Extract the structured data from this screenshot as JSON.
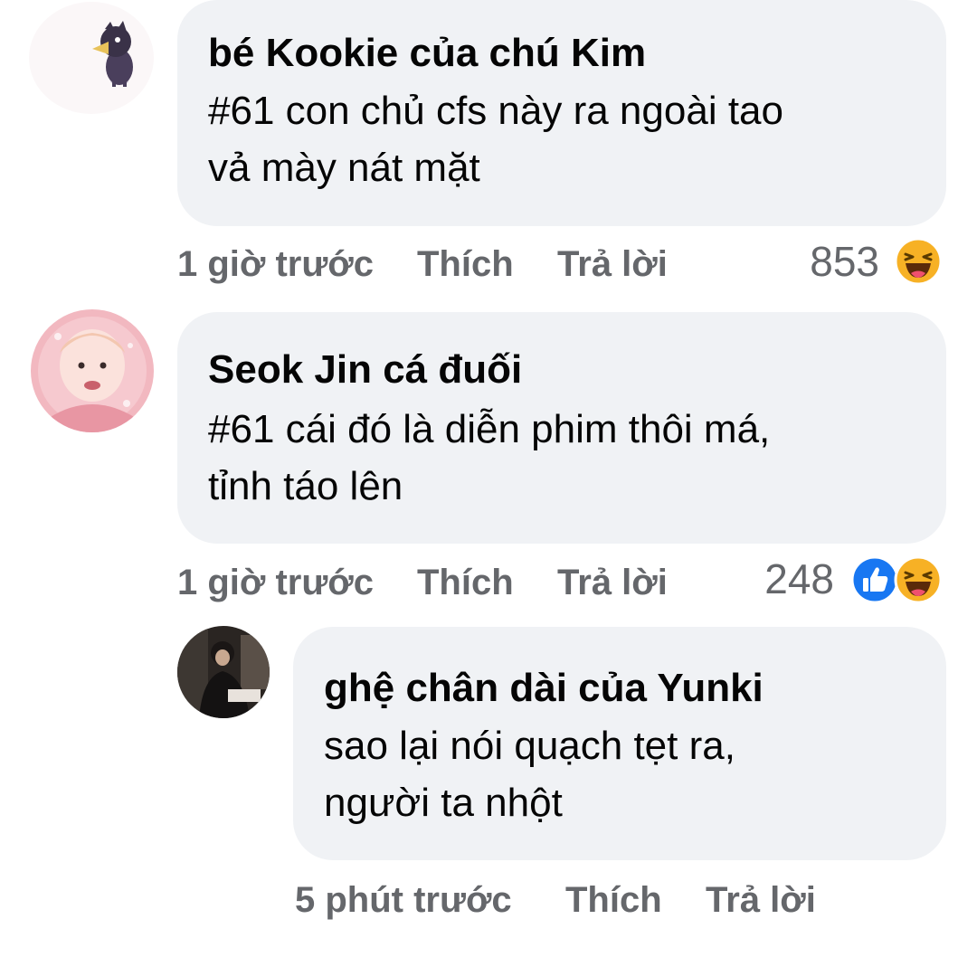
{
  "comments": [
    {
      "author": "bé Kookie của chú Kim",
      "lines": [
        "#61 con chủ cfs này ra ngoài tao",
        "vả mày nát mặt"
      ],
      "time": "1 giờ trước",
      "like_label": "Thích",
      "reply_label": "Trả lời",
      "reaction_count": "853",
      "reactions": [
        "haha-icon"
      ]
    },
    {
      "author": "Seok Jin cá đuối",
      "lines": [
        "#61 cái đó là diễn phim thôi má,",
        "tỉnh táo lên"
      ],
      "time": "1 giờ trước",
      "like_label": "Thích",
      "reply_label": "Trả lời",
      "reaction_count": "248",
      "reactions": [
        "like-icon",
        "haha-icon"
      ]
    },
    {
      "author": "ghệ chân dài của Yunki",
      "lines": [
        "sao lại nói quạch tẹt ra,",
        "người ta nhột"
      ],
      "time": "5 phút trước",
      "like_label": "Thích",
      "reply_label": "Trả lời"
    }
  ],
  "colors": {
    "bubble": "#f0f2f5",
    "meta_text": "#65676b",
    "like_blue": "#1877f2",
    "haha_yellow": "#f7b125"
  }
}
